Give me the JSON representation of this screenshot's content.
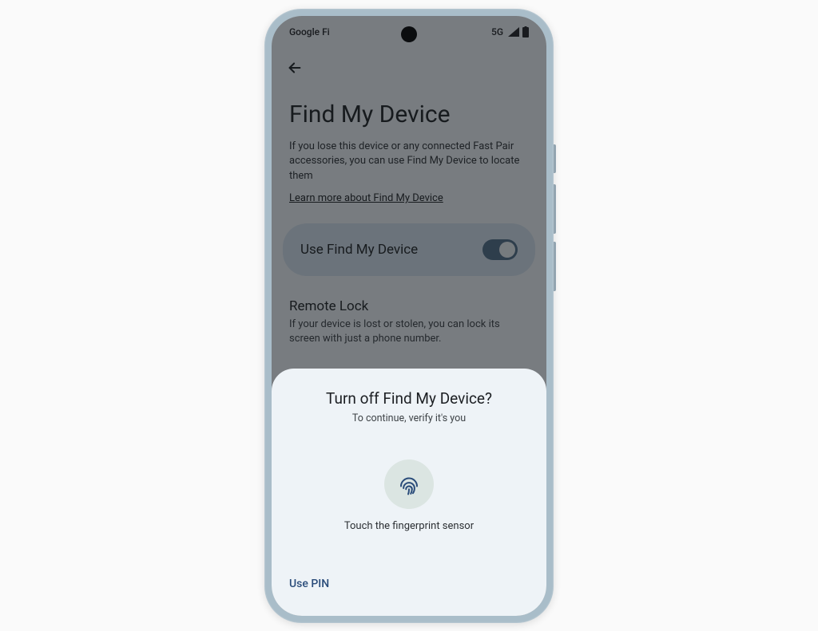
{
  "status": {
    "carrier": "Google Fi",
    "network": "5G"
  },
  "page": {
    "title": "Find My Device",
    "description": "If you lose this device or any connected Fast Pair accessories, you can use Find My Device to locate them",
    "learn_more": "Learn more about Find My Device"
  },
  "toggle": {
    "label": "Use Find My Device",
    "state": "on"
  },
  "remote_lock": {
    "title": "Remote Lock",
    "description": "If your device is lost or stolen, you can lock its screen with just a phone number."
  },
  "sheet": {
    "title": "Turn off Find My Device?",
    "subtitle": "To continue, verify it's you",
    "fingerprint_instruction": "Touch the fingerprint sensor",
    "use_pin": "Use PIN"
  }
}
